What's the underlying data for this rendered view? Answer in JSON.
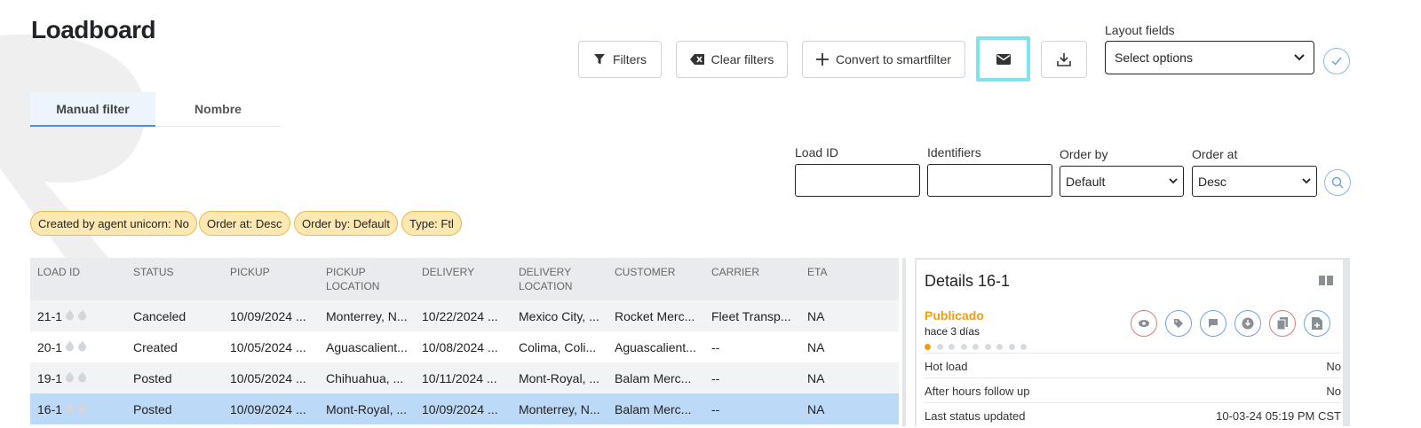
{
  "page": {
    "title": "Loadboard"
  },
  "toolbar": {
    "filters_label": "Filters",
    "clear_filters_label": "Clear filters",
    "convert_label": "Convert to smartfilter"
  },
  "layout_fields": {
    "label": "Layout fields",
    "value": "Select options"
  },
  "tabs": [
    {
      "label": "Manual filter",
      "active": true
    },
    {
      "label": "Nombre",
      "active": false
    }
  ],
  "search": {
    "load_id_label": "Load ID",
    "load_id_value": "",
    "identifiers_label": "Identifiers",
    "identifiers_value": "",
    "order_by_label": "Order by",
    "order_by_value": "Default",
    "order_at_label": "Order at",
    "order_at_value": "Desc"
  },
  "chips": [
    "Created by agent unicorn: No",
    "Order at: Desc",
    "Order by: Default",
    "Type: Ftl"
  ],
  "table": {
    "headers": [
      "LOAD ID",
      "STATUS",
      "PICKUP",
      "PICKUP LOCATION",
      "DELIVERY",
      "DELIVERY LOCATION",
      "CUSTOMER",
      "CARRIER",
      "ETA"
    ],
    "rows": [
      {
        "load_id": "21-1",
        "status": "Canceled",
        "pickup": "10/09/2024 ...",
        "pickup_location": "Monterrey, N...",
        "delivery": "10/22/2024 ...",
        "delivery_location": "Mexico City, ...",
        "customer": "Rocket Merc...",
        "carrier": "Fleet Transp...",
        "eta": "NA",
        "selected": false
      },
      {
        "load_id": "20-1",
        "status": "Created",
        "pickup": "10/05/2024 ...",
        "pickup_location": "Aguascalient...",
        "delivery": "10/08/2024 ...",
        "delivery_location": "Colima, Coli...",
        "customer": "Aguascalient...",
        "carrier": "--",
        "eta": "NA",
        "selected": false
      },
      {
        "load_id": "19-1",
        "status": "Posted",
        "pickup": "10/05/2024 ...",
        "pickup_location": "Chihuahua, ...",
        "delivery": "10/11/2024 ...",
        "delivery_location": "Mont-Royal, ...",
        "customer": "Balam Merc...",
        "carrier": "--",
        "eta": "NA",
        "selected": false
      },
      {
        "load_id": "16-1",
        "status": "Posted",
        "pickup": "10/09/2024 ...",
        "pickup_location": "Mont-Royal, ...",
        "delivery": "10/09/2024 ...",
        "delivery_location": "Monterrey, N...",
        "customer": "Balam Merc...",
        "carrier": "--",
        "eta": "NA",
        "selected": true
      }
    ]
  },
  "details": {
    "title": "Details 16-1",
    "status": "Publicado",
    "time_ago": "hace 3 días",
    "progress_step": 1,
    "progress_total": 9,
    "rows": [
      {
        "label": "Hot load",
        "value": "No"
      },
      {
        "label": "After hours follow up",
        "value": "No"
      },
      {
        "label": "Last status updated",
        "value": "10-03-24 05:19 PM CST"
      }
    ]
  },
  "colors": {
    "chip_bg": "#fde8b2",
    "chip_border": "#e7b84c",
    "selected_row": "#bcd9f7",
    "status_orange": "#f39c12",
    "highlight_border": "#7fe3ee"
  }
}
